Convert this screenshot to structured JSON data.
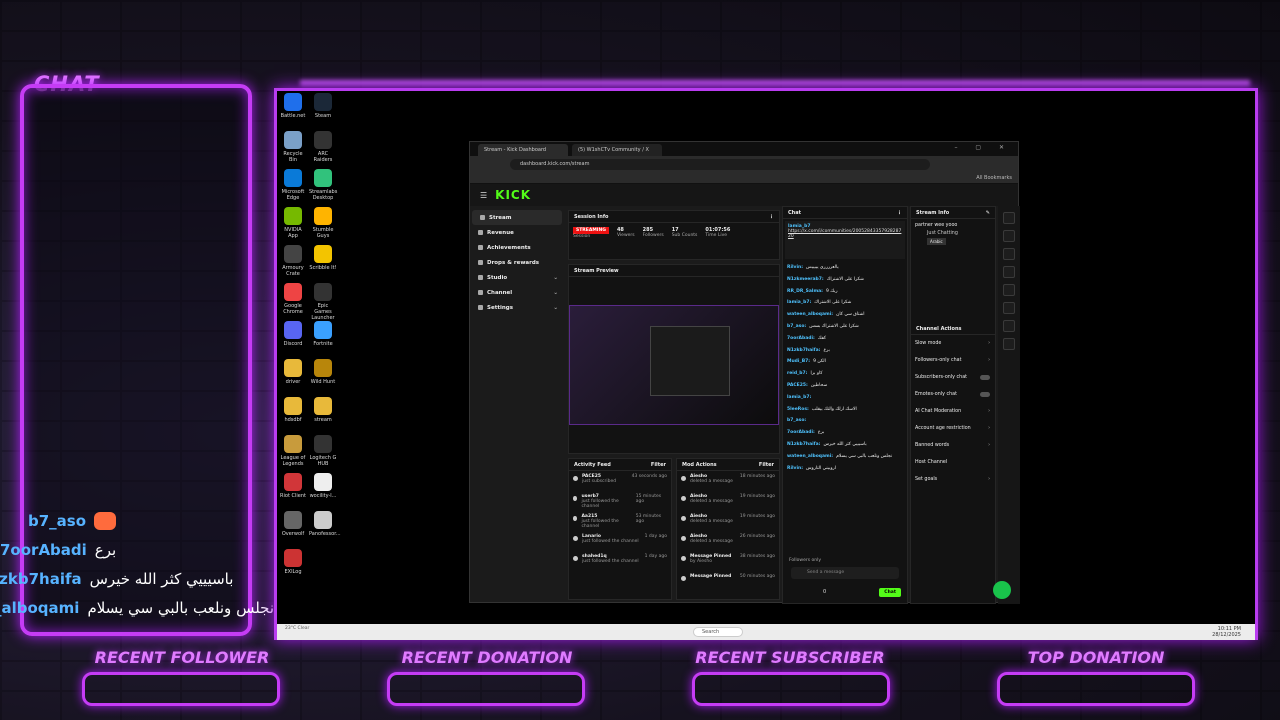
{
  "overlay": {
    "chat_title": "CHAT",
    "chat_messages": [
      {
        "user": "b7_aso",
        "text": ""
      },
      {
        "user": "7oorAbadi",
        "text": "برع"
      },
      {
        "user": "lzkb7haifa",
        "text": "باسيييي كثر الله خيرس"
      },
      {
        "user": "_alboqami",
        "text": "نجلس ونلعب بالبي سي يسلام"
      }
    ],
    "bottom_labels": [
      "RECENT FOLLOWER",
      "RECENT DONATION",
      "RECENT SUBSCRIBER",
      "TOP DONATION"
    ]
  },
  "desktop_icons": [
    "Battle.net",
    "Steam",
    "Recycle Bin",
    "ARC Raiders",
    "Microsoft Edge",
    "Streamlabs Desktop",
    "NVIDIA App",
    "Stumble Guys",
    "Armoury Crate",
    "Scribble It!",
    "Google Chrome",
    "Epic Games Launcher",
    "Discord",
    "Fortnite",
    "driver",
    "Wild Hunt",
    "hdsdbf",
    "stream",
    "League of Legends",
    "Logitech G HUB",
    "Riot Client",
    "wocility-l...",
    "Overwolf",
    "Panofessor...",
    "EXILog"
  ],
  "browser": {
    "tabs": [
      "Stream - Kick Dashboard",
      "(5) W1shCTv Community / X"
    ],
    "url": "dashboard.kick.com/stream",
    "bookmarks": "All Bookmarks",
    "logo": "KICK"
  },
  "sidebar": [
    "Stream",
    "Revenue",
    "Achievements",
    "Drops & rewards",
    "Studio",
    "Channel",
    "Settings"
  ],
  "session": {
    "title": "Session Info",
    "badge": "STREAMING",
    "stats": [
      {
        "label": "Session",
        "value": ""
      },
      {
        "label": "Viewers",
        "value": "48"
      },
      {
        "label": "Followers",
        "value": "285"
      },
      {
        "label": "Sub Counts",
        "value": "17"
      },
      {
        "label": "Time Live",
        "value": "01:07:56"
      }
    ]
  },
  "preview_title": "Stream Preview",
  "activity": {
    "title": "Activity Feed",
    "filter": "Filter",
    "rows": [
      {
        "name": "PACE25",
        "sub": "just subscribed",
        "time": "43 seconds ago"
      },
      {
        "name": "userb7",
        "sub": "just followed the channel",
        "time": "15 minutes ago"
      },
      {
        "name": "Aa215",
        "sub": "just followed the channel",
        "time": "53 minutes ago"
      },
      {
        "name": "Lanario",
        "sub": "just followed the channel",
        "time": "1 day ago"
      },
      {
        "name": "shahed1q",
        "sub": "just followed the channel",
        "time": "1 day ago"
      }
    ]
  },
  "mod": {
    "title": "Mod Actions",
    "filter": "Filter",
    "rows": [
      {
        "name": "Aiesho",
        "sub": "deleted a message",
        "time": "18 minutes ago"
      },
      {
        "name": "Aiesho",
        "sub": "deleted a message",
        "time": "19 minutes ago"
      },
      {
        "name": "Aiesho",
        "sub": "deleted a message",
        "time": "19 minutes ago"
      },
      {
        "name": "Aiesho",
        "sub": "deleted a message",
        "time": "26 minutes ago"
      },
      {
        "name": "Message Pinned",
        "sub": "by Aiesho",
        "time": "38 minutes ago"
      },
      {
        "name": "Message Pinned",
        "sub": "",
        "time": "50 minutes ago"
      }
    ]
  },
  "chat": {
    "title": "Chat",
    "pinned_user": "lamia_b7",
    "pinned_link": "https://x.com/i/communities/2005284335792828720",
    "messages": [
      {
        "user": "Rilvin:",
        "text": "يالعرررري يييييس"
      },
      {
        "user": "N1zkmeerab7:",
        "text": "شكرا على الاشتراك"
      },
      {
        "user": "RR_DR_Salma:",
        "text": "9 ربك"
      },
      {
        "user": "lamia_b7:",
        "text": "شكرا على الاشتراك"
      },
      {
        "user": "wateen_alboqami:",
        "text": "اشتاق سي كان"
      },
      {
        "user": "b7_aso:",
        "text": "شكرا على الاشتراك بسس"
      },
      {
        "user": "7oorAbadi:",
        "text": "كفك"
      },
      {
        "user": "N1zkb7haifa:",
        "text": "برع"
      },
      {
        "user": "Mudi_B7:",
        "text": "الكن 9"
      },
      {
        "user": "reid_b7:",
        "text": "كاو برا"
      },
      {
        "user": "PACE25:",
        "text": "سحاطين"
      },
      {
        "user": "lamia_b7:",
        "text": ""
      },
      {
        "user": "5leeRos:",
        "text": "الاسك ارلك والتك بيقلب"
      },
      {
        "user": "b7_aso:",
        "text": ""
      },
      {
        "user": "7oorAbadi:",
        "text": "برع"
      },
      {
        "user": "N1zkb7haifa:",
        "text": "باسيييي كثر الله خيرس"
      },
      {
        "user": "wateen_alboqami:",
        "text": "نجلس ونلعب بالبي سي يسلام"
      },
      {
        "user": "Rilvin:",
        "text": "اروبيني التاروس"
      }
    ],
    "followers_only": "Followers only",
    "send_placeholder": "Send a message",
    "counter": "0",
    "send_label": "Chat"
  },
  "stream_info": {
    "title": "Stream Info",
    "stream_title": "partner wee yooo",
    "category": "Just Chatting",
    "tag": "Arabic"
  },
  "channel_actions": {
    "title": "Channel Actions",
    "items": [
      {
        "label": "Slow mode",
        "kind": "arrow"
      },
      {
        "label": "Followers-only chat",
        "kind": "arrow"
      },
      {
        "label": "Subscribers-only chat",
        "kind": "toggle"
      },
      {
        "label": "Emotes-only chat",
        "kind": "toggle"
      },
      {
        "label": "AI Chat Moderation",
        "kind": "arrow"
      },
      {
        "label": "Account age restriction",
        "kind": "arrow"
      },
      {
        "label": "Banned words",
        "kind": "arrow"
      },
      {
        "label": "Host Channel",
        "kind": "none"
      },
      {
        "label": "Set goals",
        "kind": "arrow"
      }
    ]
  },
  "taskbar": {
    "weather": "23°C Clear",
    "search": "Search",
    "time": "10:11 PM",
    "date": "28/12/2025"
  }
}
